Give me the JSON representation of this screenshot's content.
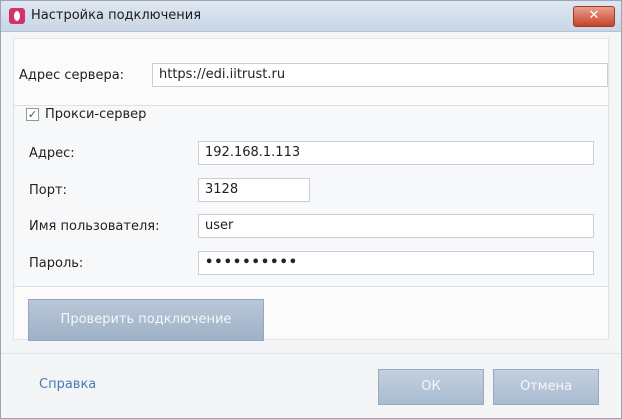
{
  "window": {
    "title": "Настройка подключения",
    "close_glyph": "✕"
  },
  "server": {
    "label": "Адрес сервера:",
    "value": "https://edi.iitrust.ru"
  },
  "proxy": {
    "checkbox_label": "Прокси-сервер",
    "checked": true,
    "address_label": "Адрес:",
    "address_value": "192.168.1.113",
    "port_label": "Порт:",
    "port_value": "3128",
    "user_label": "Имя пользователя:",
    "user_value": "user",
    "password_label": "Пароль:",
    "password_value": "••••••••••"
  },
  "actions": {
    "check_connection": "Проверить подключение",
    "help": "Справка",
    "ok": "ОК",
    "cancel": "Отмена"
  },
  "icons": {
    "app": "app-icon",
    "close": "close-icon",
    "check": "checkmark-icon"
  }
}
